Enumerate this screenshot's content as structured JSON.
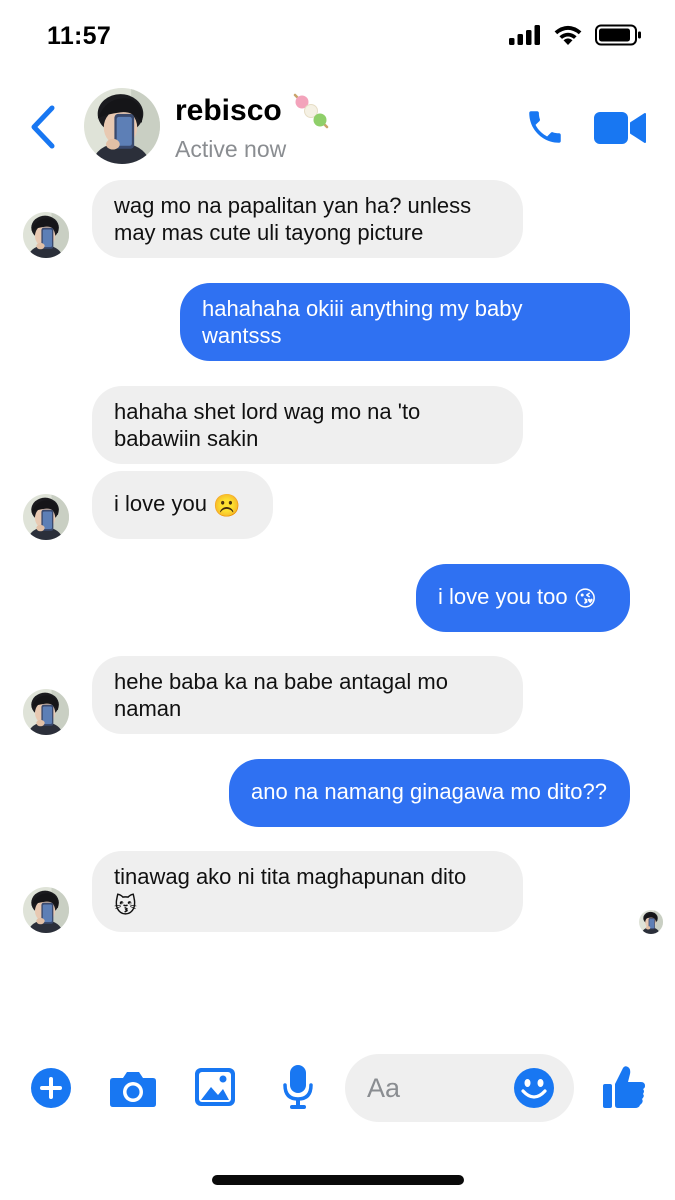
{
  "status_bar": {
    "time": "11:57"
  },
  "header": {
    "contact_name": "rebisco",
    "name_emoji": "dango-icon",
    "presence": "Active now",
    "accent_color": "#1877f2"
  },
  "messages": [
    {
      "direction": "incoming",
      "text": "wag mo na papalitan yan ha? unless may mas cute uli tayong picture",
      "show_avatar": true
    },
    {
      "direction": "outgoing",
      "text": "hahahaha okiii anything my baby wantsss"
    },
    {
      "direction": "incoming",
      "text": "hahaha shet lord wag mo na 'to babawiin sakin",
      "show_avatar": false
    },
    {
      "direction": "incoming",
      "text": "i love you",
      "emoji": "☹️",
      "show_avatar": true
    },
    {
      "direction": "outgoing",
      "text": "i love you too",
      "emoji": "😘"
    },
    {
      "direction": "incoming",
      "text": "hehe baba ka na babe antagal mo naman",
      "show_avatar": true
    },
    {
      "direction": "outgoing",
      "text": "ano na namang ginagawa mo dito??"
    },
    {
      "direction": "incoming",
      "text": "tinawag ako ni tita maghapunan dito",
      "emoji": "😽",
      "show_avatar": true
    }
  ],
  "composer": {
    "placeholder": "Aa",
    "icons": [
      "plus-icon",
      "camera-icon",
      "image-icon",
      "microphone-icon",
      "emoji-icon",
      "like-icon"
    ]
  },
  "colors": {
    "outgoing_bubble": "#2f71f2",
    "incoming_bubble": "#efefef",
    "icon_blue": "#1877f2",
    "presence_gray": "#8a8d91"
  }
}
